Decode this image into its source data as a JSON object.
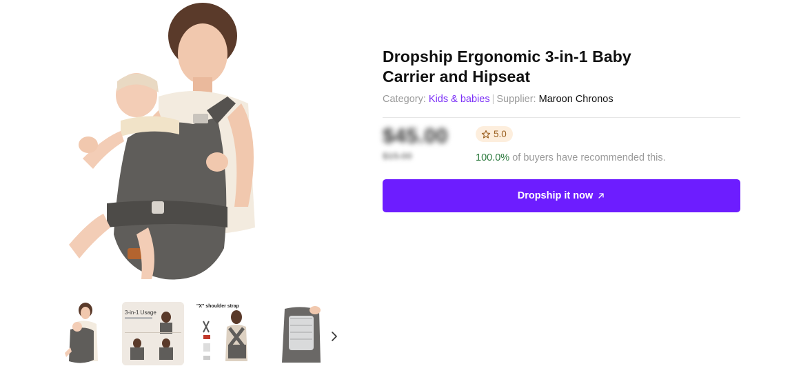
{
  "product": {
    "title": "Dropship Ergonomic 3-in-1 Baby Carrier and Hipseat",
    "category_label": "Category:",
    "category_value": "Kids & babies",
    "supplier_label": "Supplier:",
    "supplier_value": "Maroon Chronos"
  },
  "pricing": {
    "price": "$45.00",
    "original_price": "$15.00"
  },
  "rating": {
    "value": "5.0",
    "icon": "star-icon"
  },
  "recommendation": {
    "percent": "100.0%",
    "text": "of buyers have recommended this."
  },
  "cta": {
    "label": "Dropship it now",
    "icon": "arrow-up-right-icon"
  },
  "gallery": {
    "thumb2_title": "3-in-1 Usage",
    "thumb3_title": "\"X\" shoulder strap",
    "next_icon": "chevron-right-icon"
  },
  "colors": {
    "accent": "#6d1dff",
    "link": "#7b2ff7",
    "badge_bg": "#fdeedd",
    "positive": "#2c7a3e"
  }
}
